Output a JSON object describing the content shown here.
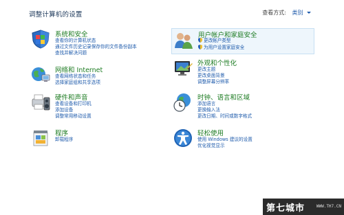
{
  "header": {
    "title": "调整计算机的设置",
    "view_by_label": "查看方式:",
    "view_by_value": "类别"
  },
  "categories": [
    {
      "heading": "系统和安全",
      "icon": "shield-flag-icon",
      "links": [
        "查看你的计算机状态",
        "通过文件历史记录保存你的文件备份副本",
        "查找并解决问题"
      ]
    },
    {
      "heading": "网络和 Internet",
      "icon": "network-globe-icon",
      "links": [
        "查看网络状态和任务",
        "选择家庭组和共享选项"
      ]
    },
    {
      "heading": "硬件和声音",
      "icon": "printer-speaker-icon",
      "links": [
        "查看设备和打印机",
        "添加设备",
        "调整常用移动设置"
      ]
    },
    {
      "heading": "程序",
      "icon": "programs-icon",
      "links": [
        "卸载程序"
      ]
    },
    {
      "heading": "用户帐户和家庭安全",
      "icon": "users-icon",
      "links": [
        "更改帐户类型",
        "为用户设置家庭安全"
      ]
    },
    {
      "heading": "外观和个性化",
      "icon": "appearance-icon",
      "links": [
        "更改主题",
        "更改桌面背景",
        "调整屏幕分辨率"
      ]
    },
    {
      "heading": "时钟、语言和区域",
      "icon": "clock-globe-icon",
      "links": [
        "添加语言",
        "更换输入法",
        "更改日期、时间或数字格式"
      ]
    },
    {
      "heading": "轻松使用",
      "icon": "ease-of-access-icon",
      "links": [
        "使用 Windows 建议的设置",
        "优化视觉显示"
      ]
    }
  ],
  "watermark": {
    "main": "第七城市",
    "site": "WWW.TH7.CN"
  }
}
